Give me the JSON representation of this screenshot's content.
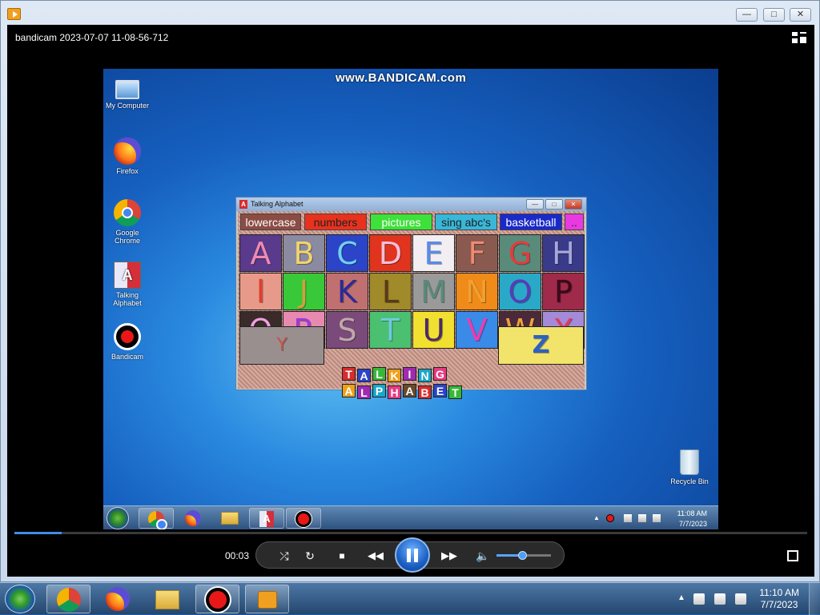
{
  "player": {
    "video_title": "bandicam 2023-07-07 11-08-56-712",
    "timecode": "00:03",
    "progress": 0.06,
    "volume": 0.47
  },
  "recorded_desktop": {
    "watermark": "www.BANDICAM.com",
    "icons": {
      "my_computer": "My Computer",
      "firefox": "Firefox",
      "chrome": "Google Chrome",
      "talking_alphabet": "Talking Alphabet",
      "bandicam": "Bandicam",
      "recycle_bin": "Recycle Bin"
    },
    "clock_time": "11:08 AM",
    "clock_date": "7/7/2023"
  },
  "talking_alphabet": {
    "title": "Talking Alphabet",
    "menu": [
      "lowercase",
      "numbers",
      "pictures",
      "sing abc's",
      "basketball",
      ".."
    ],
    "letters": [
      "A",
      "B",
      "C",
      "D",
      "E",
      "F",
      "G",
      "H",
      "I",
      "J",
      "K",
      "L",
      "M",
      "N",
      "O",
      "P",
      "Q",
      "R",
      "S",
      "T",
      "U",
      "V",
      "W",
      "X"
    ],
    "letter_y": "Y",
    "letter_z": "Z",
    "logo_line1": "TALKING",
    "logo_line2": "ALPHABET"
  },
  "taskbar": {
    "clock_time": "11:10 AM",
    "clock_date": "7/7/2023"
  },
  "colors": {
    "accent": "#3f8ee8",
    "player_bg": "#000000"
  }
}
